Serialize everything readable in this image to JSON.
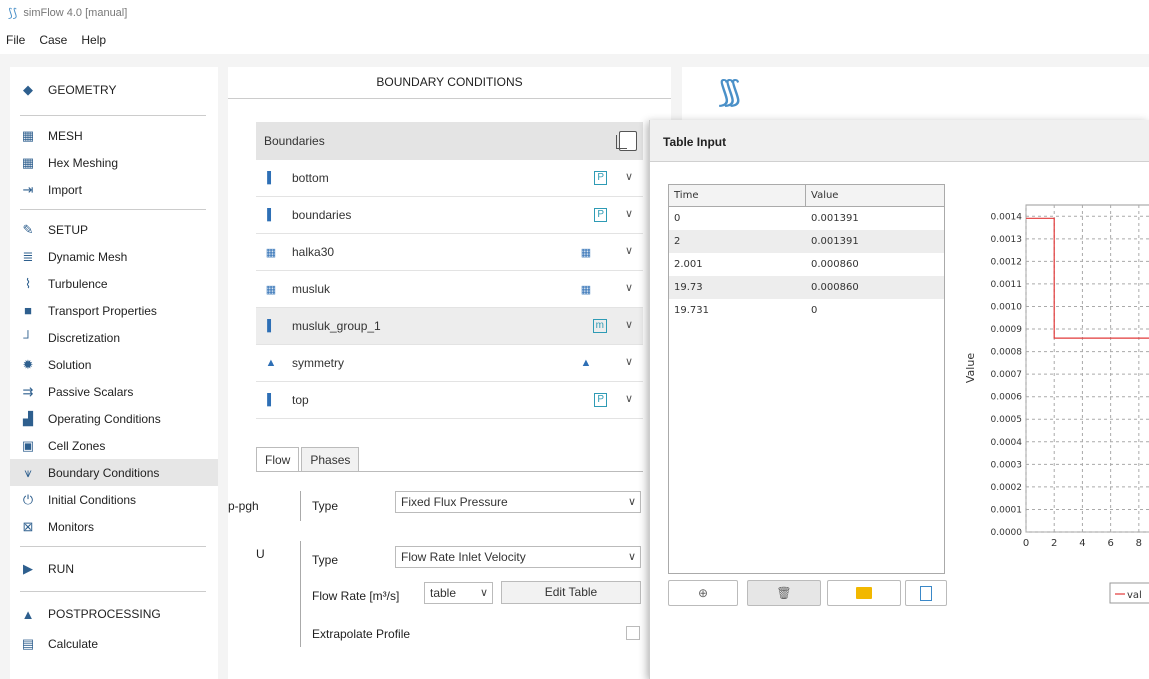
{
  "app": {
    "title": "simFlow 4.0 [manual]",
    "menu": [
      "File",
      "Case",
      "Help"
    ]
  },
  "sidebar": {
    "items": [
      {
        "label": "GEOMETRY",
        "icon": "geometry-icon",
        "section": true
      },
      {
        "label": "MESH",
        "icon": "mesh-icon",
        "section": true
      },
      {
        "label": "Hex Meshing",
        "icon": "hex-meshing-icon"
      },
      {
        "label": "Import",
        "icon": "import-icon"
      },
      {
        "label": "SETUP",
        "icon": "wrench-icon",
        "section": true
      },
      {
        "label": "Dynamic Mesh",
        "icon": "dynamic-mesh-icon"
      },
      {
        "label": "Turbulence",
        "icon": "turbulence-icon"
      },
      {
        "label": "Transport Properties",
        "icon": "truck-icon"
      },
      {
        "label": "Discretization",
        "icon": "discretization-icon"
      },
      {
        "label": "Solution",
        "icon": "gear-icon"
      },
      {
        "label": "Passive Scalars",
        "icon": "passive-scalars-icon"
      },
      {
        "label": "Operating Conditions",
        "icon": "operating-conditions-icon"
      },
      {
        "label": "Cell Zones",
        "icon": "cell-zones-icon"
      },
      {
        "label": "Boundary Conditions",
        "icon": "boundary-conditions-icon",
        "active": true
      },
      {
        "label": "Initial Conditions",
        "icon": "initial-conditions-icon"
      },
      {
        "label": "Monitors",
        "icon": "monitors-icon"
      },
      {
        "label": "RUN",
        "icon": "play-icon",
        "section": true
      },
      {
        "label": "POSTPROCESSING",
        "icon": "postprocessing-icon",
        "section": true
      },
      {
        "label": "Calculate",
        "icon": "calculator-icon"
      }
    ]
  },
  "boundary_conditions": {
    "title": "BOUNDARY CONDITIONS",
    "boundaries_header": "Boundaries",
    "boundaries": [
      {
        "name": "bottom",
        "type": "P"
      },
      {
        "name": "boundaries",
        "type": "P"
      },
      {
        "name": "halka30",
        "type": ""
      },
      {
        "name": "musluk",
        "type": ""
      },
      {
        "name": "musluk_group_1",
        "type": "m",
        "selected": true
      },
      {
        "name": "symmetry",
        "type": ""
      },
      {
        "name": "top",
        "type": "P"
      }
    ],
    "tabs": [
      "Flow",
      "Phases"
    ],
    "p_pgh": {
      "field": "p-pgh",
      "type_label": "Type",
      "type_value": "Fixed Flux Pressure"
    },
    "U": {
      "field": "U",
      "type_label": "Type",
      "type_value": "Flow Rate Inlet Velocity",
      "flow_rate_label": "Flow Rate [m³/s]",
      "flow_rate_mode": "table",
      "edit_table_label": "Edit Table",
      "extrapolate_label": "Extrapolate Profile",
      "extrapolate_checked": false
    }
  },
  "table_input": {
    "title": "Table Input",
    "columns": [
      "Time",
      "Value"
    ],
    "rows": [
      [
        "0",
        "0.001391"
      ],
      [
        "2",
        "0.001391"
      ],
      [
        "2.001",
        "0.000860"
      ],
      [
        "19.73",
        "0.000860"
      ],
      [
        "19.731",
        "0"
      ]
    ],
    "buttons": [
      "add-icon",
      "trash-icon",
      "folder-icon",
      "preview-icon"
    ]
  },
  "chart_data": {
    "type": "line",
    "x": [
      0,
      2,
      2.001,
      19.73,
      19.731
    ],
    "series": [
      {
        "name": "val",
        "values": [
          0.001391,
          0.001391,
          0.00086,
          0.00086,
          0
        ],
        "color": "#e23a3a"
      }
    ],
    "ylabel": "Value",
    "xlabel": "",
    "y_ticks": [
      "0.0000",
      "0.0001",
      "0.0002",
      "0.0003",
      "0.0004",
      "0.0005",
      "0.0006",
      "0.0007",
      "0.0008",
      "0.0009",
      "0.0010",
      "0.0011",
      "0.0012",
      "0.0013",
      "0.0014"
    ],
    "x_ticks": [
      "0",
      "2",
      "4",
      "6",
      "8"
    ],
    "xlim": [
      0,
      9.5
    ],
    "ylim": [
      0,
      0.00145
    ],
    "grid": true,
    "legend": "bottom",
    "legend_label": "val"
  }
}
